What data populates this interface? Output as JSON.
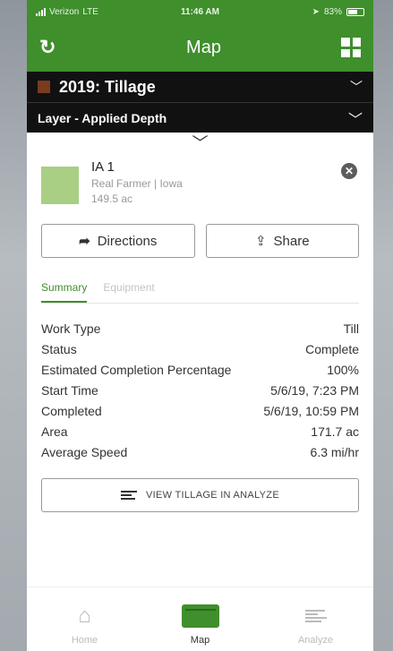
{
  "status_bar": {
    "carrier": "Verizon",
    "network": "LTE",
    "time": "11:46 AM",
    "battery": "83%"
  },
  "header": {
    "title": "Map"
  },
  "operation": {
    "name": "2019: Tillage",
    "layer": "Layer - Applied Depth",
    "swatch_color": "#7a3b1f"
  },
  "field": {
    "name": "IA 1",
    "owner": "Real Farmer | Iowa",
    "area": "149.5 ac",
    "thumb_color": "#a8cf84"
  },
  "actions": {
    "directions": "Directions",
    "share": "Share"
  },
  "tabs": [
    {
      "label": "Summary",
      "active": true
    },
    {
      "label": "Equipment",
      "active": false
    }
  ],
  "summary_rows": [
    {
      "label": "Work Type",
      "value": "Till"
    },
    {
      "label": "Status",
      "value": "Complete"
    },
    {
      "label": "Estimated Completion Percentage",
      "value": "100%"
    },
    {
      "label": "Start Time",
      "value": "5/6/19, 7:23 PM"
    },
    {
      "label": "Completed",
      "value": "5/6/19, 10:59 PM"
    },
    {
      "label": "Area",
      "value": "171.7 ac"
    },
    {
      "label": "Average Speed",
      "value": "6.3 mi/hr"
    }
  ],
  "analyze_button": "VIEW TILLAGE IN ANALYZE",
  "bottom_nav": [
    {
      "label": "Home"
    },
    {
      "label": "Map"
    },
    {
      "label": "Analyze"
    }
  ],
  "colors": {
    "brand_green": "#3f8f2c",
    "header_dark": "#111111"
  }
}
